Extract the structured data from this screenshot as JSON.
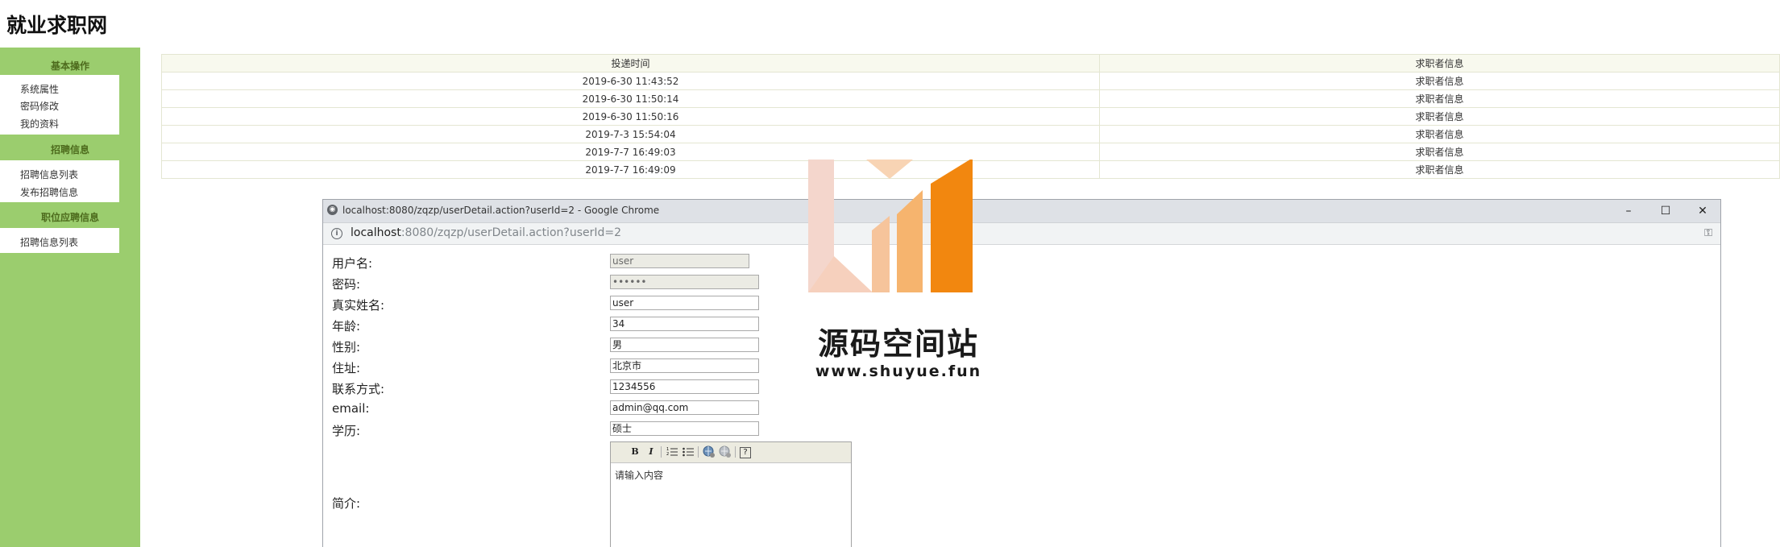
{
  "site": {
    "title": "就业求职网"
  },
  "sidebar": {
    "sections": [
      {
        "title": "基本操作",
        "items": [
          "系统属性",
          "密码修改",
          "我的资料"
        ]
      },
      {
        "title": "招聘信息",
        "items": [
          "招聘信息列表",
          "发布招聘信息"
        ]
      },
      {
        "title": "职位应聘信息",
        "items": [
          "招聘信息列表"
        ]
      }
    ]
  },
  "table": {
    "headers": [
      "投递时间",
      "求职者信息"
    ],
    "rows": [
      [
        "2019-6-30 11:43:52",
        "求职者信息"
      ],
      [
        "2019-6-30 11:50:14",
        "求职者信息"
      ],
      [
        "2019-6-30 11:50:16",
        "求职者信息"
      ],
      [
        "2019-7-3 15:54:04",
        "求职者信息"
      ],
      [
        "2019-7-7 16:49:03",
        "求职者信息"
      ],
      [
        "2019-7-7 16:49:09",
        "求职者信息"
      ]
    ]
  },
  "popup": {
    "window_title": "localhost:8080/zqzp/userDetail.action?userId=2 - Google Chrome",
    "url_host": "localhost",
    "url_path": ":8080/zqzp/userDetail.action?userId=2",
    "controls": {
      "minimize": "–",
      "maximize": "☐",
      "close": "✕"
    },
    "icons": {
      "window": "chrome-icon",
      "info": "info-icon",
      "key": "key-icon"
    },
    "form": {
      "fields": [
        {
          "label": "用户名:",
          "value": "user",
          "readonly": true
        },
        {
          "label": "密码:",
          "value": "••••••",
          "readonly": true
        },
        {
          "label": "真实姓名:",
          "value": "user"
        },
        {
          "label": "年龄:",
          "value": "34"
        },
        {
          "label": "性别:",
          "value": "男"
        },
        {
          "label": "住址:",
          "value": "北京市"
        },
        {
          "label": "联系方式:",
          "value": "1234556"
        },
        {
          "label": "email:",
          "value": "admin@qq.com"
        },
        {
          "label": "学历:",
          "value": "硕士"
        }
      ],
      "intro_label": "简介:",
      "editor": {
        "toolbar": [
          "B",
          "I",
          "ordered-list",
          "unordered-list",
          "link",
          "unlink",
          "help"
        ],
        "placeholder": "请输入内容"
      }
    }
  },
  "watermark": {
    "title": "源码空间站",
    "url": "www.shuyue.fun",
    "colors": {
      "light": "#f4d6cc",
      "mid": "#f6b46e",
      "dark": "#f2870f"
    }
  }
}
